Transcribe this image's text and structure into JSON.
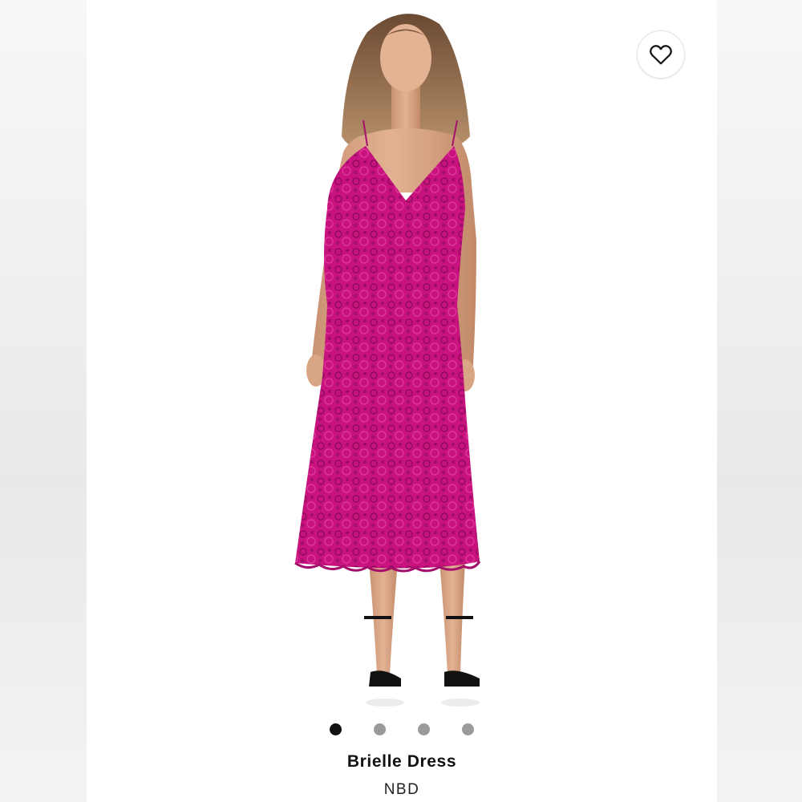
{
  "product": {
    "title": "Brielle Dress",
    "brand": "NBD"
  },
  "favorite": {
    "icon": "heart-outline-icon"
  },
  "carousel": {
    "total": 4,
    "active_index": 0
  },
  "colors": {
    "dress": "#c8137f",
    "active_dot": "#111111",
    "inactive_dot": "#9a9a9a"
  }
}
